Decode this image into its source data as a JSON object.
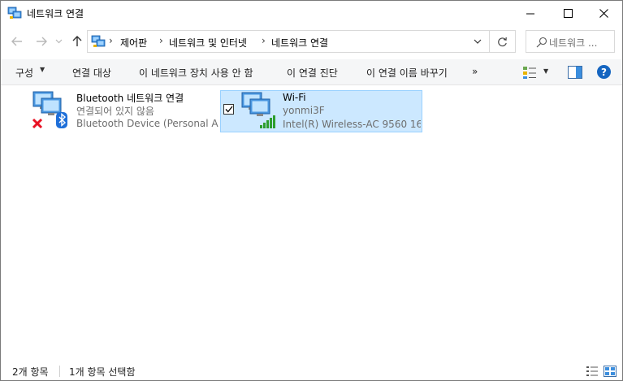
{
  "window": {
    "title": "네트워크 연결",
    "minimize_icon": "minimize-icon",
    "maximize_icon": "maximize-icon",
    "close_icon": "close-icon"
  },
  "nav": {
    "back_icon": "arrow-left-icon",
    "forward_icon": "arrow-right-icon",
    "recent_icon": "chevron-down-icon",
    "up_icon": "arrow-up-icon"
  },
  "address": {
    "breadcrumbs": [
      "제어판",
      "네트워크 및 인터넷",
      "네트워크 연결"
    ],
    "separator": "›"
  },
  "search": {
    "placeholder": "네트워크 ..."
  },
  "commands": {
    "organize": "구성",
    "connect_to": "연결 대상",
    "disable": "이 네트워크 장치 사용 안 함",
    "diagnose": "이 연결 진단",
    "rename": "이 연결 이름 바꾸기",
    "more": "»"
  },
  "items": [
    {
      "name": "Bluetooth 네트워크 연결",
      "status": "연결되어 있지 않음",
      "device": "Bluetooth Device (Personal A...",
      "selected": false
    },
    {
      "name": "Wi-Fi",
      "status": "yonmi3F",
      "device": "Intel(R) Wireless-AC 9560 16...",
      "selected": true
    }
  ],
  "status": {
    "count": "2개 항목",
    "selected": "1개 항목 선택함"
  },
  "colors": {
    "selection_bg": "#cce8ff",
    "selection_border": "#99d1ff",
    "help_blue": "#1565c0",
    "signal_green": "#2e9e2e",
    "error_red": "#e81123",
    "bluetooth_blue": "#1e6fd9"
  }
}
